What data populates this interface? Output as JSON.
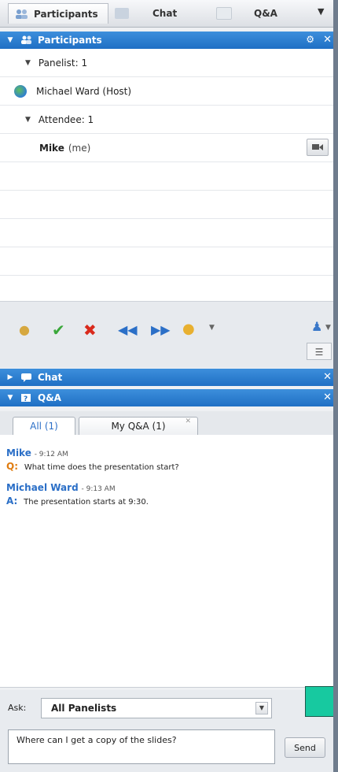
{
  "tabs": {
    "participants": "Participants",
    "chat": "Chat",
    "qa": "Q&A"
  },
  "participants_panel": {
    "title": "Participants",
    "groups": [
      {
        "label": "Panelist: 1",
        "members": [
          {
            "name": "Michael Ward (Host)"
          }
        ]
      },
      {
        "label": "Attendee: 1",
        "members": [
          {
            "name": "Mike",
            "suffix": "(me)"
          }
        ]
      }
    ]
  },
  "chat_panel": {
    "title": "Chat"
  },
  "qa_panel": {
    "title": "Q&A",
    "tabs": [
      "All (1)",
      "My Q&A (1)"
    ],
    "messages": [
      {
        "author": "Mike",
        "time": "- 9:12 AM",
        "prefix": "Q:",
        "text": "What time does the presentation start?"
      },
      {
        "author": "Michael Ward",
        "time": "- 9:13 AM",
        "prefix": "A:",
        "text": "The presentation starts at 9:30."
      }
    ]
  },
  "ask": {
    "label": "Ask:",
    "selected": "All Panelists",
    "input_value": "Where can I get a copy of the slides?",
    "send_label": "Send"
  },
  "colors": {
    "header_blue": "#1f6fc4",
    "name_blue": "#2b6fc7",
    "question_orange": "#e07c10",
    "marker_green": "#17c9a0"
  }
}
